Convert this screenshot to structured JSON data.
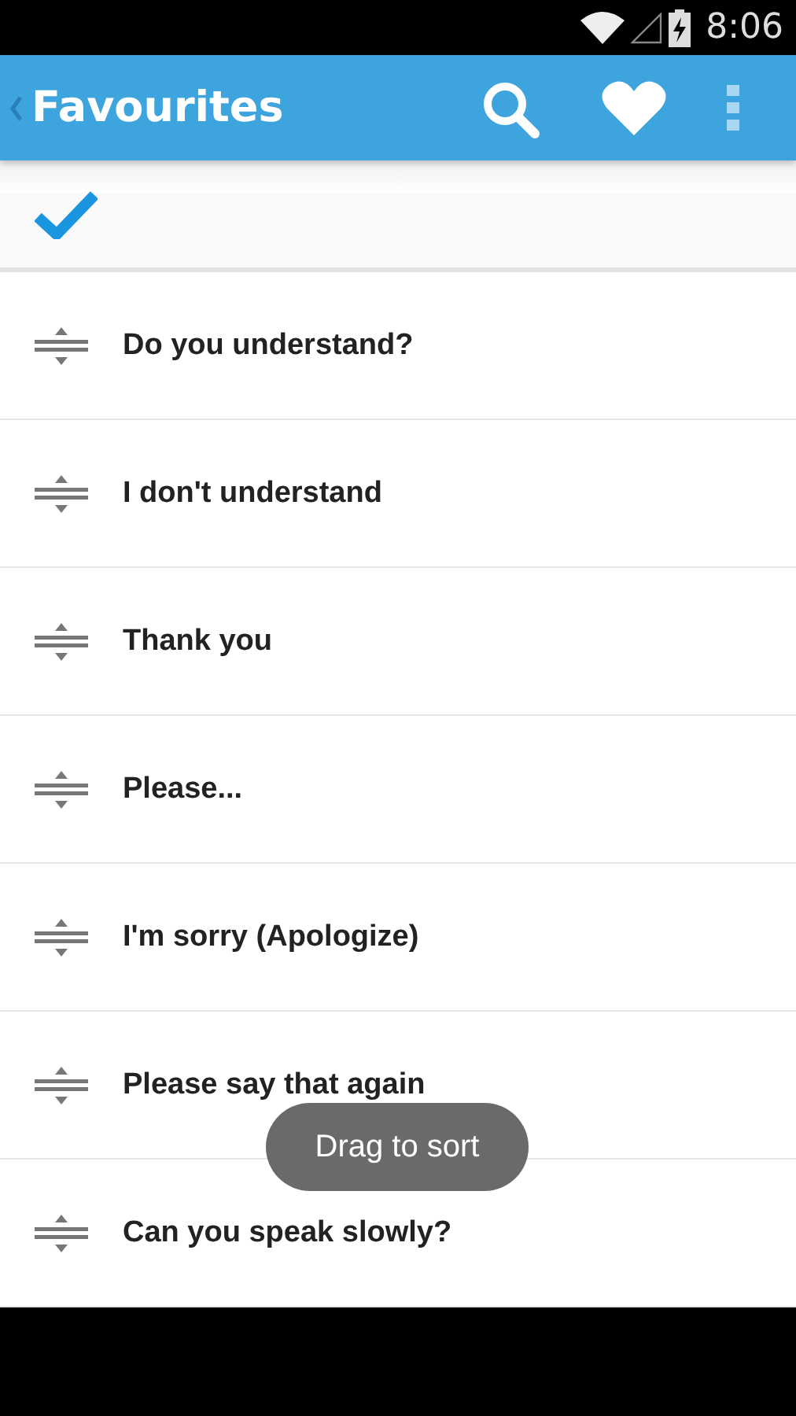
{
  "status_bar": {
    "time": "8:06"
  },
  "app_bar": {
    "title": "Favourites"
  },
  "phrases": [
    {
      "text": "Do you understand?"
    },
    {
      "text": "I don't understand"
    },
    {
      "text": "Thank you"
    },
    {
      "text": "Please..."
    },
    {
      "text": "I'm sorry (Apologize)"
    },
    {
      "text": "Please say that again"
    },
    {
      "text": "Can you speak slowly?"
    }
  ],
  "toast": {
    "text": "Drag to sort"
  }
}
